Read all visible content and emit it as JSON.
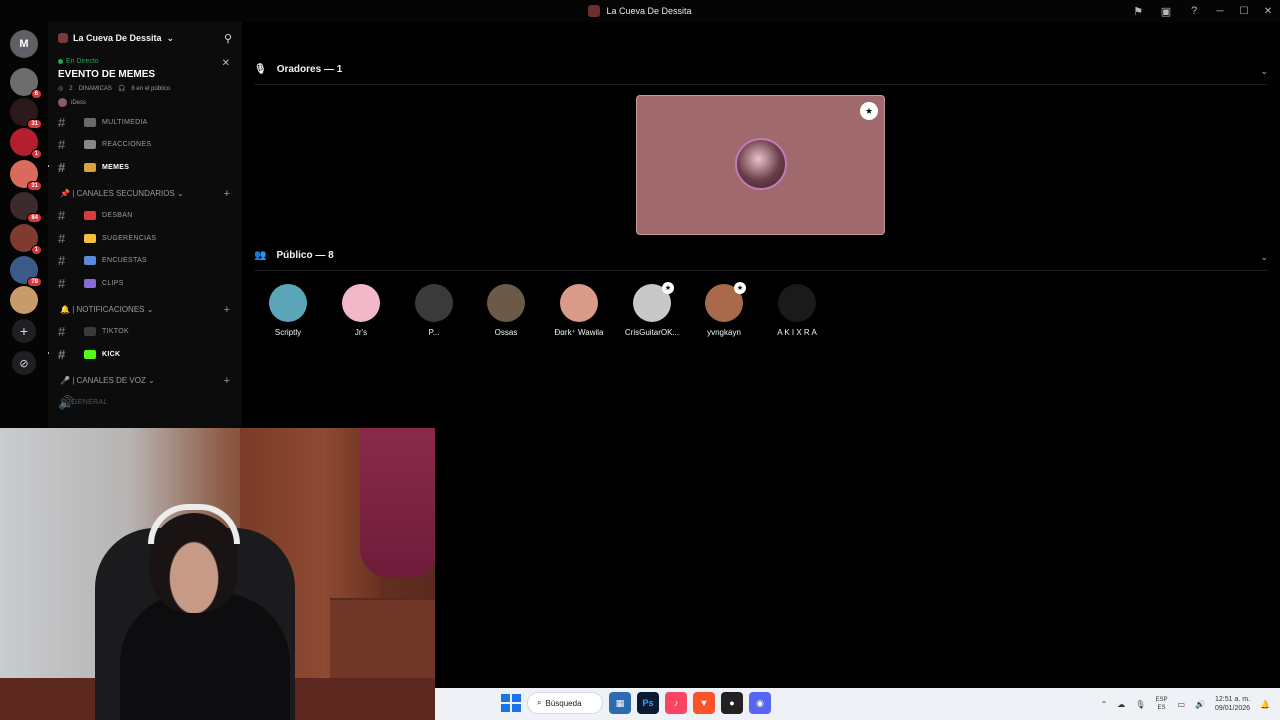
{
  "window": {
    "title": "La Cueva De Dessita"
  },
  "servers": [
    {
      "badge": "6",
      "color": "#6d6d6d"
    },
    {
      "badge": "31",
      "color": "#2a1a1a"
    },
    {
      "badge": "1",
      "color": "#b31f2d"
    },
    {
      "badge": "31",
      "color": "#d96b5c"
    },
    {
      "badge": "84",
      "color": "#3d2a2a"
    },
    {
      "badge": "1",
      "color": "#7f3b2e"
    },
    {
      "badge": "78",
      "color": "#3a5a8a"
    },
    {
      "badge": "",
      "color": "#c89a6a"
    }
  ],
  "guild": {
    "name": "La Cueva De Dessita"
  },
  "event": {
    "status": "En Directo",
    "title": "EVENTO DE MEMES",
    "topic": "DINAMICAS",
    "topic_prefix": "2",
    "audience": "8 en el público",
    "host": "iDess"
  },
  "channels_top": [
    {
      "name": "MULTIMEDIA",
      "emoji_color": "#6a6a6a",
      "active": false
    },
    {
      "name": "REACCIONES",
      "emoji_color": "#888888",
      "active": false
    },
    {
      "name": "MEMES",
      "emoji_color": "#d9a23a",
      "active": true
    }
  ],
  "categories": {
    "secondary": "| CANALES SECUNDARIOS",
    "notifications": "| NOTIFICACIONES",
    "voice": "| CANALES DE VOZ"
  },
  "channels_secondary": [
    {
      "name": "DESBAN",
      "emoji_color": "#d83c3e"
    },
    {
      "name": "SUGERENCIAS",
      "emoji_color": "#f0c23a"
    },
    {
      "name": "ENCUESTAS",
      "emoji_color": "#5a8bd8"
    },
    {
      "name": "CLIPS",
      "emoji_color": "#8a6ad8"
    }
  ],
  "channels_notifications": [
    {
      "name": "TIKTOK",
      "emoji_color": "#3a3a3a",
      "active": false
    },
    {
      "name": "KICK",
      "emoji_color": "#53fc18",
      "active": true
    }
  ],
  "voice_partial": "GENERAL",
  "stage": {
    "speakers_header": "Oradores — 1",
    "audience_header": "Público — 8"
  },
  "audience": [
    {
      "name": "Scriptly",
      "color": "#5aa6b8",
      "mod": false
    },
    {
      "name": "Jr's",
      "color": "#f2b7c8",
      "mod": false
    },
    {
      "name": "P...",
      "color": "#3a3a3a",
      "mod": false
    },
    {
      "name": "Ossas",
      "color": "#6b5a48",
      "mod": false
    },
    {
      "name": "Ðαrk⁺ Wawila",
      "color": "#d99a88",
      "mod": false
    },
    {
      "name": "CrisGuitarOK...",
      "color": "#c8c8c8",
      "mod": true
    },
    {
      "name": "yvngkayn",
      "color": "#a86a4a",
      "mod": true
    },
    {
      "name": "A K I X R A",
      "color": "#1a1a1a",
      "mod": false
    }
  ],
  "taskbar": {
    "search_label": "Búsqueda",
    "lang_top": "ESP",
    "lang_bottom": "ES",
    "time": "12:51 a. m.",
    "date": "09/01/2026"
  }
}
